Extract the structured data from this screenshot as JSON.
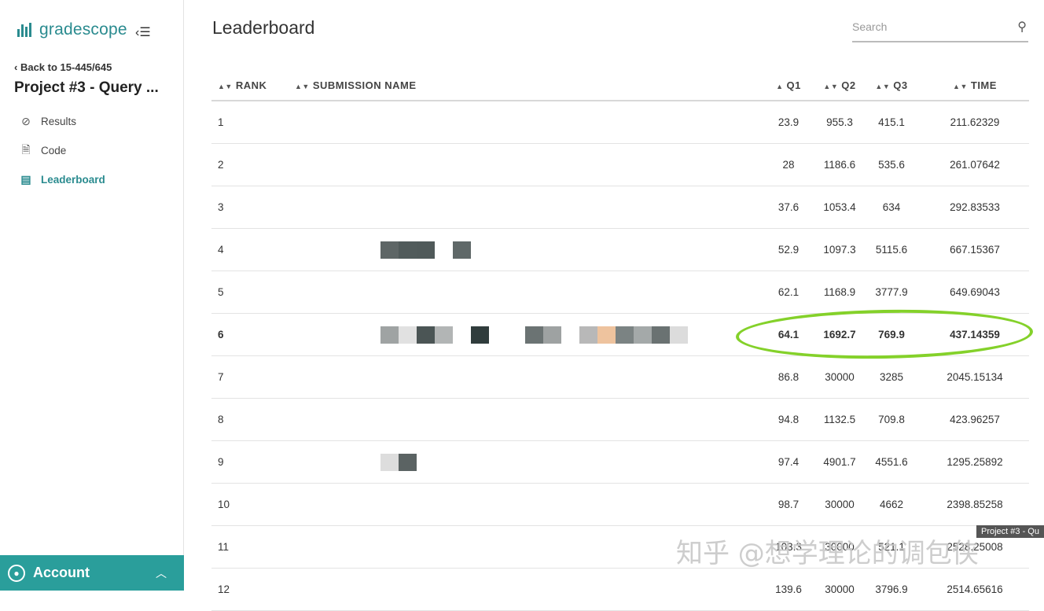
{
  "brand": {
    "name": "gradescope"
  },
  "sidebar": {
    "back_link": "Back to 15-445/645",
    "course_title": "Project #3 - Query ...",
    "nav": [
      {
        "label": "Results",
        "icon": "check-circle-icon"
      },
      {
        "label": "Code",
        "icon": "code-file-icon"
      },
      {
        "label": "Leaderboard",
        "icon": "leaderboard-icon",
        "active": true
      }
    ],
    "account_label": "Account"
  },
  "main": {
    "title": "Leaderboard",
    "search_placeholder": "Search",
    "columns": [
      "RANK",
      "SUBMISSION NAME",
      "Q1",
      "Q2",
      "Q3",
      "TIME"
    ],
    "rows": [
      [
        "1",
        "",
        "23.9",
        "955.3",
        "415.1",
        "211.62329"
      ],
      [
        "2",
        "",
        "28",
        "1186.6",
        "535.6",
        "261.07642"
      ],
      [
        "3",
        "",
        "37.6",
        "1053.4",
        "634",
        "292.83533"
      ],
      [
        "4",
        "",
        "52.9",
        "1097.3",
        "5115.6",
        "667.15367"
      ],
      [
        "5",
        "",
        "62.1",
        "1168.9",
        "3777.9",
        "649.69043"
      ],
      [
        "6",
        "",
        "64.1",
        "1692.7",
        "769.9",
        "437.14359"
      ],
      [
        "7",
        "",
        "86.8",
        "30000",
        "3285",
        "2045.15134"
      ],
      [
        "8",
        "",
        "94.8",
        "1132.5",
        "709.8",
        "423.96257"
      ],
      [
        "9",
        "",
        "97.4",
        "4901.7",
        "4551.6",
        "1295.25892"
      ],
      [
        "10",
        "",
        "98.7",
        "30000",
        "4662",
        "2398.85258"
      ],
      [
        "11",
        "",
        "103.3",
        "30000",
        "521.1",
        "2528.25008"
      ],
      [
        "12",
        "",
        "139.6",
        "30000",
        "3796.9",
        "2514.65616"
      ]
    ],
    "highlight_color": "#84d12a"
  },
  "overlay": {
    "watermark": "知乎 @想学理论的调包侠",
    "tooltip": "Project #3 - Qu"
  }
}
